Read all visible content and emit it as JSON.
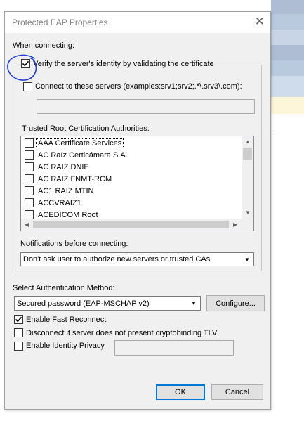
{
  "dialog": {
    "title": "Protected EAP Properties",
    "close_glyph": "✕"
  },
  "connecting": {
    "label": "When connecting:",
    "verify_label": "Verify the server's identity by validating the certificate",
    "verify_checked": true,
    "connect_label": "Connect to these servers (examples:srv1;srv2;.*\\.srv3\\.com):",
    "connect_checked": false,
    "servers_value": ""
  },
  "trusted_roots": {
    "label": "Trusted Root Certification Authorities:",
    "items": [
      {
        "label": "AAA Certificate Services",
        "checked": false
      },
      {
        "label": "AC Raíz Certicámara S.A.",
        "checked": false
      },
      {
        "label": "AC RAIZ DNIE",
        "checked": false
      },
      {
        "label": "AC RAIZ FNMT-RCM",
        "checked": false
      },
      {
        "label": "AC1 RAIZ MTIN",
        "checked": false
      },
      {
        "label": "ACCVRAIZ1",
        "checked": false
      },
      {
        "label": "ACEDICOM Root",
        "checked": false
      }
    ]
  },
  "notifications": {
    "label": "Notifications before connecting:",
    "value": "Don't ask user to authorize new servers or trusted CAs"
  },
  "auth_method": {
    "label": "Select Authentication Method:",
    "value": "Secured password (EAP-MSCHAP v2)",
    "configure_label": "Configure..."
  },
  "options": {
    "fast_reconnect_label": "Enable Fast Reconnect",
    "fast_reconnect_checked": true,
    "cryptobinding_label": "Disconnect if server does not present cryptobinding TLV",
    "cryptobinding_checked": false,
    "identity_privacy_label": "Enable Identity Privacy",
    "identity_privacy_checked": false,
    "identity_value": ""
  },
  "buttons": {
    "ok_label": "OK",
    "cancel_label": "Cancel"
  },
  "colors": {
    "annotation_circle": "#1f3fd1",
    "default_button_border": "#0078d7"
  }
}
